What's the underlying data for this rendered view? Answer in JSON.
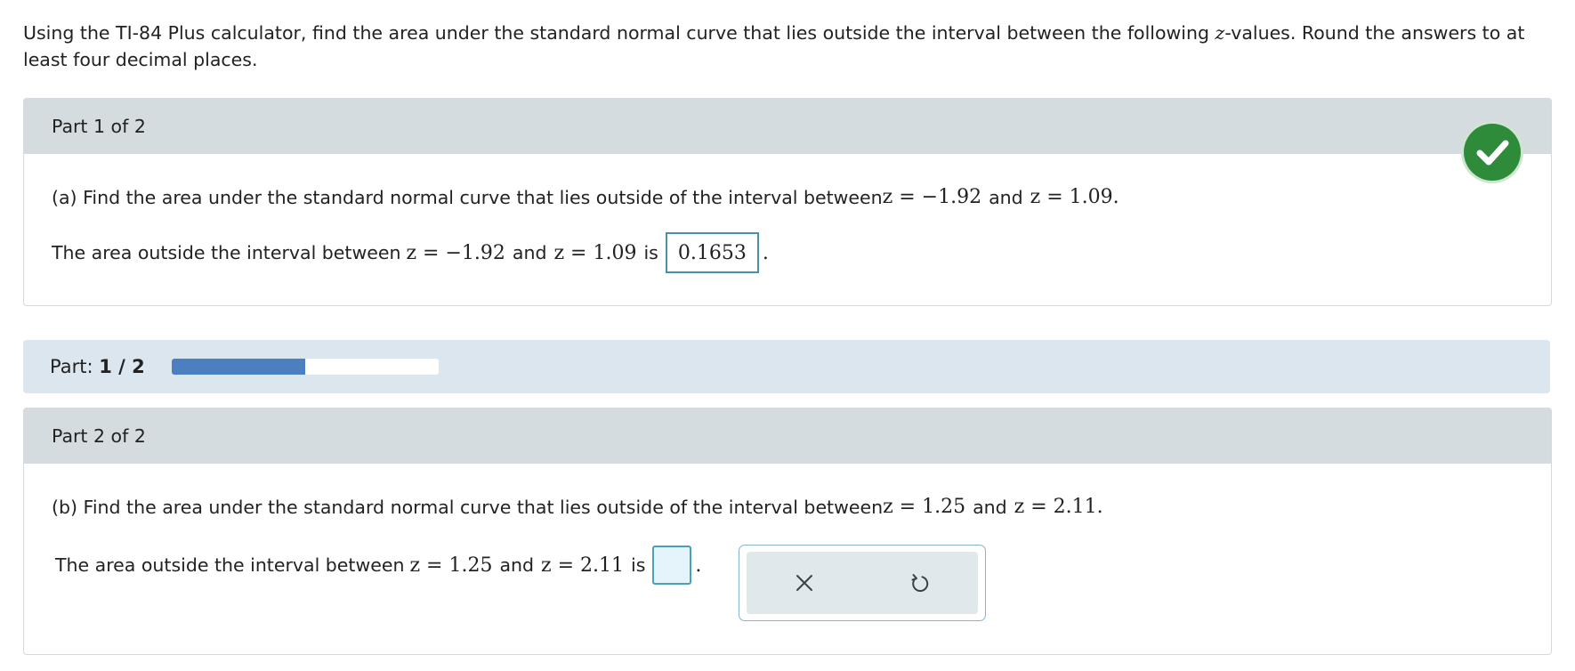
{
  "question": {
    "intro_pre": "Using the TI-84 Plus calculator, find the area under the standard normal curve that lies outside the interval between the following ",
    "intro_var": "z",
    "intro_post": "-values. Round the answers to at least four decimal places."
  },
  "part1": {
    "header": "Part 1 of 2",
    "question_prefix": "(a) Find the area under the standard normal curve that lies outside of the interval between ",
    "z1": "z = −1.92",
    "and": "and",
    "z2": "z = 1.09",
    "question_end": ".",
    "answer_prefix": "The area outside the interval between ",
    "is": "is",
    "answer_value": "0.1653",
    "answer_end": ".",
    "status": "correct"
  },
  "progress": {
    "label": "Part:",
    "current_total": "1 / 2",
    "fraction": 0.5
  },
  "part2": {
    "header": "Part 2 of 2",
    "question_prefix": "(b) Find the area under the standard normal curve that lies outside of the interval between ",
    "z1": "z = 1.25",
    "and": "and",
    "z2": "z = 2.11",
    "question_end": ".",
    "answer_prefix": "The area outside the interval between ",
    "is": "is",
    "answer_value": "",
    "answer_end": "."
  },
  "toolbar": {
    "clear_icon": "close-icon",
    "undo_icon": "undo-icon"
  },
  "colors": {
    "success": "#2e8b3a",
    "progress_fill": "#4b7fc0",
    "header_bg": "#d5dcdf",
    "progress_bg": "#dbe6ef"
  }
}
